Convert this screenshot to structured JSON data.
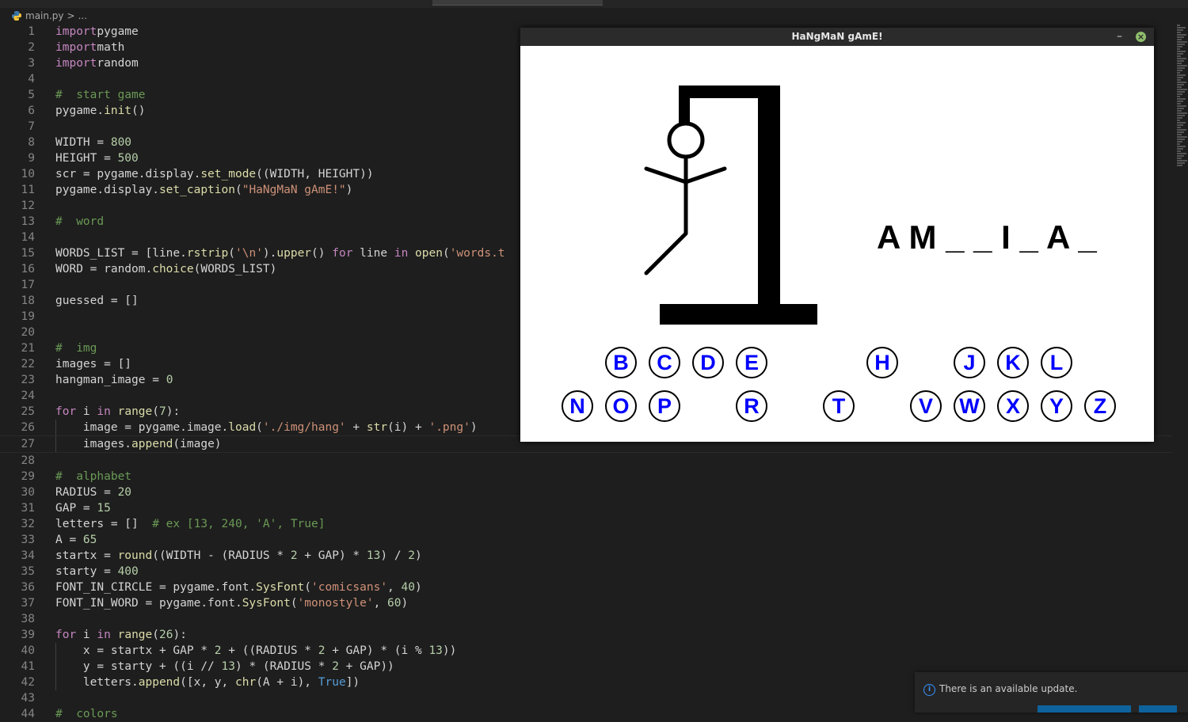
{
  "editor": {
    "breadcrumb": {
      "file": "main.py",
      "separator": ">",
      "rest": "..."
    },
    "lines": [
      {
        "n": "1",
        "t": [
          [
            "kw",
            "import"
          ],
          [
            "",
            "pygame"
          ]
        ]
      },
      {
        "n": "2",
        "t": [
          [
            "kw",
            "import"
          ],
          [
            "",
            "math"
          ]
        ]
      },
      {
        "n": "3",
        "t": [
          [
            "kw",
            "import"
          ],
          [
            "",
            "random"
          ]
        ]
      },
      {
        "n": "4",
        "t": []
      },
      {
        "n": "5",
        "t": [
          [
            "cm",
            "#  start game"
          ]
        ]
      },
      {
        "n": "6",
        "t": [
          [
            "",
            "pygame."
          ],
          [
            "fn",
            "init"
          ],
          [
            "",
            "()"
          ]
        ]
      },
      {
        "n": "7",
        "t": []
      },
      {
        "n": "8",
        "t": [
          [
            "",
            "WIDTH = "
          ],
          [
            "num",
            "800"
          ]
        ]
      },
      {
        "n": "9",
        "t": [
          [
            "",
            "HEIGHT = "
          ],
          [
            "num",
            "500"
          ]
        ]
      },
      {
        "n": "10",
        "t": [
          [
            "",
            "scr = pygame.display."
          ],
          [
            "fn",
            "set_mode"
          ],
          [
            "",
            "((WIDTH, HEIGHT))"
          ]
        ]
      },
      {
        "n": "11",
        "t": [
          [
            "",
            "pygame.display."
          ],
          [
            "fn",
            "set_caption"
          ],
          [
            "",
            "("
          ],
          [
            "str",
            "\"HaNgMaN gAmE!\""
          ],
          [
            "",
            ")"
          ]
        ]
      },
      {
        "n": "12",
        "t": []
      },
      {
        "n": "13",
        "t": [
          [
            "cm",
            "#  word"
          ]
        ]
      },
      {
        "n": "14",
        "t": []
      },
      {
        "n": "15",
        "t": [
          [
            "",
            "WORDS_LIST = [line."
          ],
          [
            "fn",
            "rstrip"
          ],
          [
            "",
            "("
          ],
          [
            "str",
            "'\\n'"
          ],
          [
            "",
            ")."
          ],
          [
            "fn",
            "upper"
          ],
          [
            "",
            "() "
          ],
          [
            "kw",
            "for"
          ],
          [
            "",
            " line "
          ],
          [
            "kw",
            "in"
          ],
          [
            "",
            ""
          ],
          [
            "fn",
            " open"
          ],
          [
            "",
            "("
          ],
          [
            "str",
            "'words.t"
          ]
        ]
      },
      {
        "n": "16",
        "t": [
          [
            "",
            "WORD = random."
          ],
          [
            "fn",
            "choice"
          ],
          [
            "",
            "(WORDS_LIST)"
          ]
        ]
      },
      {
        "n": "17",
        "t": []
      },
      {
        "n": "18",
        "t": [
          [
            "",
            "guessed = []"
          ]
        ]
      },
      {
        "n": "19",
        "t": []
      },
      {
        "n": "20",
        "t": []
      },
      {
        "n": "21",
        "t": [
          [
            "cm",
            "#  img"
          ]
        ]
      },
      {
        "n": "22",
        "t": [
          [
            "",
            "images = []"
          ]
        ]
      },
      {
        "n": "23",
        "t": [
          [
            "",
            "hangman_image = "
          ],
          [
            "num",
            "0"
          ]
        ]
      },
      {
        "n": "24",
        "t": []
      },
      {
        "n": "25",
        "t": [
          [
            "kw",
            "for"
          ],
          [
            "",
            " i "
          ],
          [
            "kw",
            "in"
          ],
          [
            "",
            " "
          ],
          [
            "fn",
            "range"
          ],
          [
            "",
            "("
          ],
          [
            "num",
            "7"
          ],
          [
            "",
            "):"
          ]
        ]
      },
      {
        "n": "26",
        "indent": true,
        "t": [
          [
            "",
            "    image = pygame.image."
          ],
          [
            "fn",
            "load"
          ],
          [
            "",
            "("
          ],
          [
            "str",
            "'./img/hang'"
          ],
          [
            "",
            " + "
          ],
          [
            "fn",
            "str"
          ],
          [
            "",
            "(i) + "
          ],
          [
            "str",
            "'.png'"
          ],
          [
            "",
            ")"
          ]
        ]
      },
      {
        "n": "27",
        "indent": true,
        "current": true,
        "t": [
          [
            "",
            "    images."
          ],
          [
            "fn",
            "append"
          ],
          [
            "",
            "(image)"
          ]
        ]
      },
      {
        "n": "28",
        "t": []
      },
      {
        "n": "29",
        "t": [
          [
            "cm",
            "#  alphabet"
          ]
        ]
      },
      {
        "n": "30",
        "t": [
          [
            "",
            "RADIUS = "
          ],
          [
            "num",
            "20"
          ]
        ]
      },
      {
        "n": "31",
        "t": [
          [
            "",
            "GAP = "
          ],
          [
            "num",
            "15"
          ]
        ]
      },
      {
        "n": "32",
        "t": [
          [
            "",
            "letters = []  "
          ],
          [
            "cm",
            "# ex [13, 240, 'A', True]"
          ]
        ]
      },
      {
        "n": "33",
        "t": [
          [
            "",
            "A = "
          ],
          [
            "num",
            "65"
          ]
        ]
      },
      {
        "n": "34",
        "t": [
          [
            "",
            "startx = "
          ],
          [
            "fn",
            "round"
          ],
          [
            "",
            "((WIDTH - (RADIUS * "
          ],
          [
            "num",
            "2"
          ],
          [
            "",
            " + GAP) * "
          ],
          [
            "num",
            "13"
          ],
          [
            "",
            ") / "
          ],
          [
            "num",
            "2"
          ],
          [
            "",
            ")"
          ]
        ]
      },
      {
        "n": "35",
        "t": [
          [
            "",
            "starty = "
          ],
          [
            "num",
            "400"
          ]
        ]
      },
      {
        "n": "36",
        "t": [
          [
            "",
            "FONT_IN_CIRCLE = pygame.font."
          ],
          [
            "fn",
            "SysFont"
          ],
          [
            "",
            "("
          ],
          [
            "str",
            "'comicsans'"
          ],
          [
            "",
            ", "
          ],
          [
            "num",
            "40"
          ],
          [
            "",
            ")"
          ]
        ]
      },
      {
        "n": "37",
        "t": [
          [
            "",
            "FONT_IN_WORD = pygame.font."
          ],
          [
            "fn",
            "SysFont"
          ],
          [
            "",
            "("
          ],
          [
            "str",
            "'monostyle'"
          ],
          [
            "",
            ", "
          ],
          [
            "num",
            "60"
          ],
          [
            "",
            ")"
          ]
        ]
      },
      {
        "n": "38",
        "t": []
      },
      {
        "n": "39",
        "t": [
          [
            "kw",
            "for"
          ],
          [
            "",
            " i "
          ],
          [
            "kw",
            "in"
          ],
          [
            "",
            " "
          ],
          [
            "fn",
            "range"
          ],
          [
            "",
            "("
          ],
          [
            "num",
            "26"
          ],
          [
            "",
            "):"
          ]
        ]
      },
      {
        "n": "40",
        "indent": true,
        "t": [
          [
            "",
            "    x = startx + GAP * "
          ],
          [
            "num",
            "2"
          ],
          [
            "",
            " + ((RADIUS * "
          ],
          [
            "num",
            "2"
          ],
          [
            "",
            " + GAP) * (i % "
          ],
          [
            "num",
            "13"
          ],
          [
            "",
            "))"
          ]
        ]
      },
      {
        "n": "41",
        "indent": true,
        "t": [
          [
            "",
            "    y = starty + ((i // "
          ],
          [
            "num",
            "13"
          ],
          [
            "",
            ") * (RADIUS * "
          ],
          [
            "num",
            "2"
          ],
          [
            "",
            " + GAP))"
          ]
        ]
      },
      {
        "n": "42",
        "indent": true,
        "t": [
          [
            "",
            "    letters."
          ],
          [
            "fn",
            "append"
          ],
          [
            "",
            "([x, y, "
          ],
          [
            "fn",
            "chr"
          ],
          [
            "",
            "(A + i), "
          ],
          [
            "bl",
            "True"
          ],
          [
            "",
            "])"
          ]
        ]
      },
      {
        "n": "43",
        "t": []
      },
      {
        "n": "44",
        "t": [
          [
            "cm",
            "#  colors"
          ]
        ]
      }
    ]
  },
  "game": {
    "title": "HaNgMaN gAmE!",
    "minimize_glyph": "–",
    "close_glyph": "×",
    "word_display": "A M _ _ I _ A _",
    "row1": [
      "",
      "B",
      "C",
      "D",
      "E",
      "",
      "",
      "H",
      "",
      "J",
      "K",
      "L",
      ""
    ],
    "row2": [
      "N",
      "O",
      "P",
      "",
      "R",
      "",
      "T",
      "",
      "V",
      "W",
      "X",
      "Y",
      "Z"
    ],
    "hangman_stage": 5
  },
  "notification": {
    "icon": "i",
    "message": "There is an available update."
  },
  "colors": {
    "editor_bg": "#1e1e1e",
    "keyword": "#c586c0",
    "string": "#ce9178",
    "number": "#b5cea8",
    "comment": "#6a9955",
    "function": "#dcdcaa",
    "letter_blue": "#0000ff",
    "button_blue": "#0e639c"
  }
}
